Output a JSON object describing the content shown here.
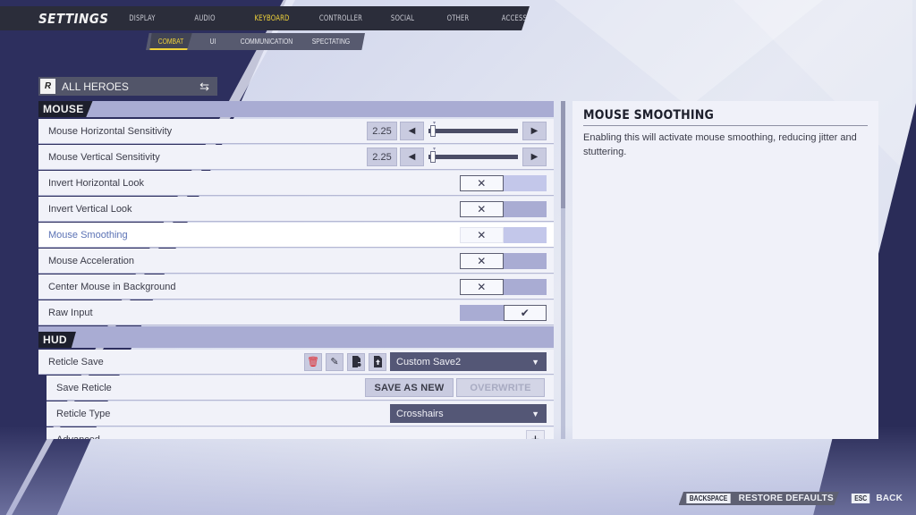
{
  "header": {
    "title": "SETTINGS",
    "tabs": [
      {
        "label": "DISPLAY",
        "active": false
      },
      {
        "label": "AUDIO",
        "active": false
      },
      {
        "label": "KEYBOARD",
        "active": true
      },
      {
        "label": "CONTROLLER",
        "active": false
      },
      {
        "label": "SOCIAL",
        "active": false
      },
      {
        "label": "OTHER",
        "active": false
      },
      {
        "label": "ACCESSIBILITY",
        "active": false
      }
    ],
    "subtabs": [
      {
        "label": "COMBAT",
        "active": true
      },
      {
        "label": "UI",
        "active": false
      },
      {
        "label": "COMMUNICATION",
        "active": false
      },
      {
        "label": "SPECTATING",
        "active": false
      }
    ],
    "accent_color": "#f0d33a"
  },
  "hero_selector": {
    "logo": "R",
    "label": "ALL HEROES",
    "icon": "swap-icon"
  },
  "sections": {
    "mouse": {
      "label": "MOUSE",
      "rows": {
        "horizontal_sensitivity": {
          "label": "Mouse Horizontal Sensitivity",
          "value": "2.25",
          "slider_fraction": 0.02
        },
        "vertical_sensitivity": {
          "label": "Mouse Vertical Sensitivity",
          "value": "2.25",
          "slider_fraction": 0.02
        },
        "invert_horizontal": {
          "label": "Invert Horizontal Look",
          "enabled": false
        },
        "invert_vertical": {
          "label": "Invert Vertical Look",
          "enabled": false
        },
        "smoothing": {
          "label": "Mouse Smoothing",
          "enabled": false,
          "selected": true
        },
        "acceleration": {
          "label": "Mouse Acceleration",
          "enabled": false
        },
        "center_background": {
          "label": "Center Mouse in Background",
          "enabled": false
        },
        "raw_input": {
          "label": "Raw Input",
          "enabled": true
        }
      }
    },
    "hud": {
      "label": "HUD",
      "rows": {
        "reticle_save": {
          "label": "Reticle Save",
          "selected_value": "Custom Save2"
        },
        "save_reticle": {
          "label": "Save Reticle",
          "save_as_new": "SAVE AS NEW",
          "overwrite": "OVERWRITE"
        },
        "reticle_type": {
          "label": "Reticle Type",
          "selected_value": "Crosshairs"
        },
        "advanced": {
          "label": "Advanced"
        }
      }
    }
  },
  "glyphs": {
    "left_arrow": "◀",
    "right_arrow": "▶",
    "cross": "✕",
    "check": "✔",
    "caret": "▼",
    "plus": "+",
    "swap": "⇆",
    "trash": "🗑",
    "edit": "✎",
    "marker": "▾"
  },
  "detail": {
    "title": "MOUSE SMOOTHING",
    "description": "Enabling this will activate mouse smoothing, reducing jitter and stuttering."
  },
  "footer": {
    "restore_key": "BACKSPACE",
    "restore_label": "RESTORE DEFAULTS",
    "back_key": "ESC",
    "back_label": "BACK"
  }
}
